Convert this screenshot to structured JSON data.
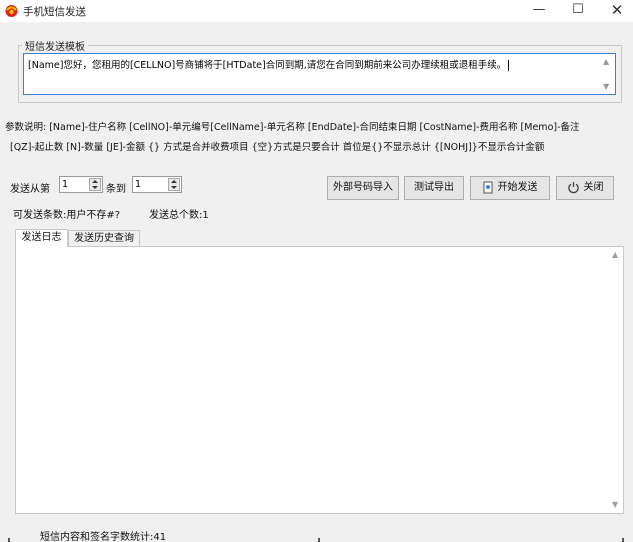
{
  "window": {
    "title": "手机短信发送",
    "minimize_glyph": "—",
    "maximize_glyph": "☐",
    "close_glyph": "✕"
  },
  "template": {
    "group_label": "短信发送模板",
    "text": "[Name]您好，您租用的[CELLNO]号商铺将于[HTDate]合同到期,请您在合同到期前来公司办理续租或退租手续。"
  },
  "params": {
    "line1": "参数说明: [Name]-住户名称 [CellNO]-单元编号[CellName]-单元名称 [EndDate]-合同结束日期 [CostName]-费用名称 [Memo]-备注",
    "line2": "[QZ]-起止数  [N]-数量  [JE]-金额  {} 方式是合并收费项目 {空}方式是只要合计 首位是{}不显示总计 {[NOHJ]}不显示合计金额"
  },
  "send_range": {
    "from_label": "发送从第",
    "from_value": "1",
    "to_label": "条到",
    "to_value": "1"
  },
  "buttons": {
    "import_label": "外部号码导入",
    "export_label": "测试导出",
    "start_label": "开始发送",
    "close_label": "关闭"
  },
  "stats": {
    "sendable": "可发送条数:用户不存#?",
    "total": "发送总个数:1"
  },
  "tabs": [
    {
      "label": "发送日志",
      "active": true
    },
    {
      "label": "发送历史查询",
      "active": false
    }
  ],
  "status": {
    "text": "短信内容和签名字数统计:41"
  },
  "icons": {
    "app": "app-logo-icon",
    "start": "send-doc-icon",
    "close": "power-icon"
  },
  "colors": {
    "accent_border": "#3a7ed8",
    "background": "#f0f0f0"
  }
}
